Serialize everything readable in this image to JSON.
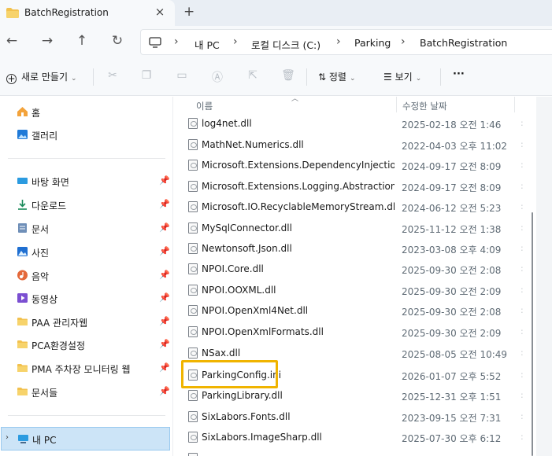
{
  "tab": {
    "title": "BatchRegistration",
    "close_glyph": "×",
    "new_glyph": "+"
  },
  "nav": {
    "back": "←",
    "forward": "→",
    "up": "↑",
    "refresh": "↻"
  },
  "breadcrumb": {
    "items": [
      "내 PC",
      "로컬 디스크 (C:)",
      "Parking",
      "BatchRegistration"
    ],
    "separator": "›"
  },
  "toolbar": {
    "new_label": "새로 만들기",
    "sort_label": "정렬",
    "view_label": "보기",
    "more_label": "···"
  },
  "sidebar": {
    "items": [
      {
        "label": "홈",
        "icon": "home-icon"
      },
      {
        "label": "갤러리",
        "icon": "gallery-icon"
      },
      {
        "label": "바탕 화면",
        "icon": "desktop-icon",
        "pinned": true
      },
      {
        "label": "다운로드",
        "icon": "download-icon",
        "pinned": true
      },
      {
        "label": "문서",
        "icon": "documents-icon",
        "pinned": true
      },
      {
        "label": "사진",
        "icon": "pictures-icon",
        "pinned": true
      },
      {
        "label": "음악",
        "icon": "music-icon",
        "pinned": true
      },
      {
        "label": "동영상",
        "icon": "videos-icon",
        "pinned": true
      },
      {
        "label": "PAA 관리자웹",
        "icon": "folder-icon",
        "pinned": true
      },
      {
        "label": "PCA환경설정",
        "icon": "folder-icon",
        "pinned": true
      },
      {
        "label": "PMA 주차장 모니터링 웹",
        "icon": "folder-icon",
        "pinned": true
      },
      {
        "label": "문서들",
        "icon": "folder-icon",
        "pinned": true
      },
      {
        "label": "내 PC",
        "icon": "pc-icon",
        "selected": true
      }
    ]
  },
  "filelist": {
    "columns": {
      "name": "이름",
      "modified": "수정한 날짜"
    },
    "rows": [
      {
        "name": "log4net.dll",
        "date": "2025-02-18 오전 1:46"
      },
      {
        "name": "MathNet.Numerics.dll",
        "date": "2022-04-03 오후 11:02"
      },
      {
        "name": "Microsoft.Extensions.DependencyInjection.Abs...",
        "date": "2024-09-17 오전 8:09"
      },
      {
        "name": "Microsoft.Extensions.Logging.Abstractions.dll",
        "date": "2024-09-17 오전 8:09"
      },
      {
        "name": "Microsoft.IO.RecyclableMemoryStream.dll",
        "date": "2024-06-12 오전 5:23"
      },
      {
        "name": "MySqlConnector.dll",
        "date": "2025-11-12 오전 1:38"
      },
      {
        "name": "Newtonsoft.Json.dll",
        "date": "2023-03-08 오후 4:09"
      },
      {
        "name": "NPOI.Core.dll",
        "date": "2025-09-30 오전 2:08"
      },
      {
        "name": "NPOI.OOXML.dll",
        "date": "2025-09-30 오전 2:09"
      },
      {
        "name": "NPOI.OpenXml4Net.dll",
        "date": "2025-09-30 오전 2:08"
      },
      {
        "name": "NPOI.OpenXmlFormats.dll",
        "date": "2025-09-30 오전 2:09"
      },
      {
        "name": "NSax.dll",
        "date": "2025-08-05 오전 10:49"
      },
      {
        "name": "ParkingConfig.ini",
        "date": "2026-01-07 오후 5:52",
        "highlighted": true
      },
      {
        "name": "ParkingLibrary.dll",
        "date": "2025-12-31 오후 1:51"
      },
      {
        "name": "SixLabors.Fonts.dll",
        "date": "2023-09-15 오전 7:31"
      },
      {
        "name": "SixLabors.ImageSharp.dll",
        "date": "2025-07-30 오후 6:12"
      }
    ]
  },
  "colors": {
    "highlight": "#f0b400",
    "selection": "#cce4f7",
    "accent": "#0067c0"
  }
}
